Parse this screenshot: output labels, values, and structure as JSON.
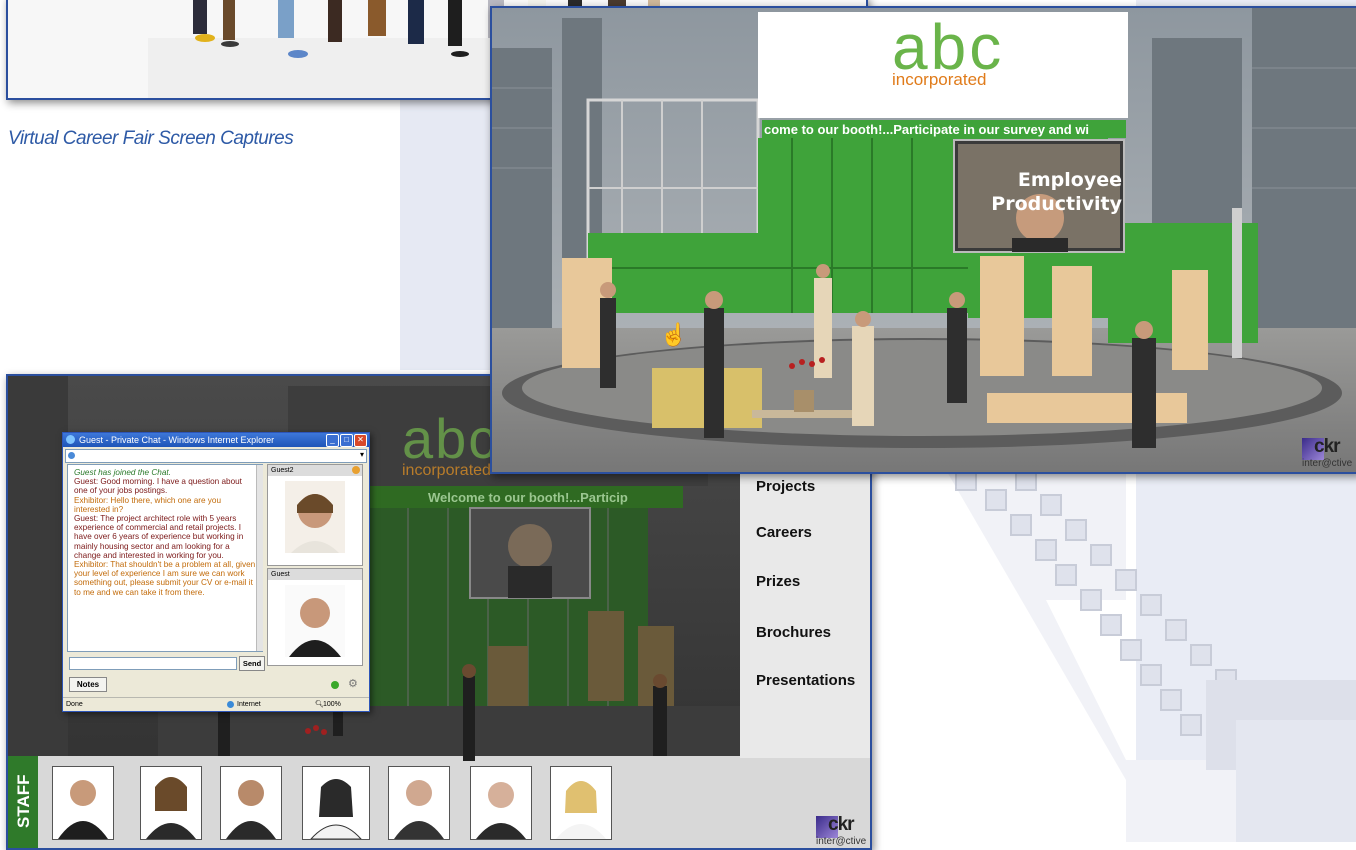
{
  "caption": "Virtual Career Fair Screen Captures",
  "brand": {
    "abc_text": "abc",
    "abc_sub": "incorporated",
    "ckr_text": "ckr",
    "ckr_sub": "inter@ctive"
  },
  "booth_top": {
    "ticker": "come to our booth!...Participate in our survey and wi",
    "screen_title_1": "Employee",
    "screen_title_2": "Productivity"
  },
  "booth_bottom": {
    "ticker": "Welcome to our booth!...Particip",
    "nav": [
      "Projects",
      "Careers",
      "Prizes",
      "Brochures",
      "Presentations"
    ],
    "staff_label": "STAFF"
  },
  "chat": {
    "title": "Guest - Private Chat - Windows Internet Explorer",
    "messages": [
      {
        "type": "sys",
        "text": "Guest  has joined the Chat."
      },
      {
        "type": "guest",
        "text": "Guest:  Good morning. I have a question about one of your jobs postings."
      },
      {
        "type": "exhib",
        "text": "Exhibitor:  Hello there, which one are you interested in?"
      },
      {
        "type": "guest",
        "text": "Guest:  The project architect role with 5 years experience of commercial and retail projects. I have over 6 years of experience but working in mainly housing sector and am looking for a change and interested in working for you."
      },
      {
        "type": "exhib",
        "text": "Exhibitor:  That shouldn't be a problem at all, given your level of experience I am sure we can work something out, please submit your CV or e-mail it to me and we can take it from there."
      }
    ],
    "participants": [
      "Guest2",
      "Guest"
    ],
    "send_label": "Send",
    "notes_label": "Notes",
    "status_left": "Done",
    "status_zone": "Internet",
    "zoom": "100%"
  },
  "colors": {
    "frame_border": "#2b4f9e",
    "booth_green": "#3fa33a",
    "abc_orange": "#e07b1a",
    "ticker_text": "#ffffff",
    "caption_blue": "#2e5aa6"
  }
}
